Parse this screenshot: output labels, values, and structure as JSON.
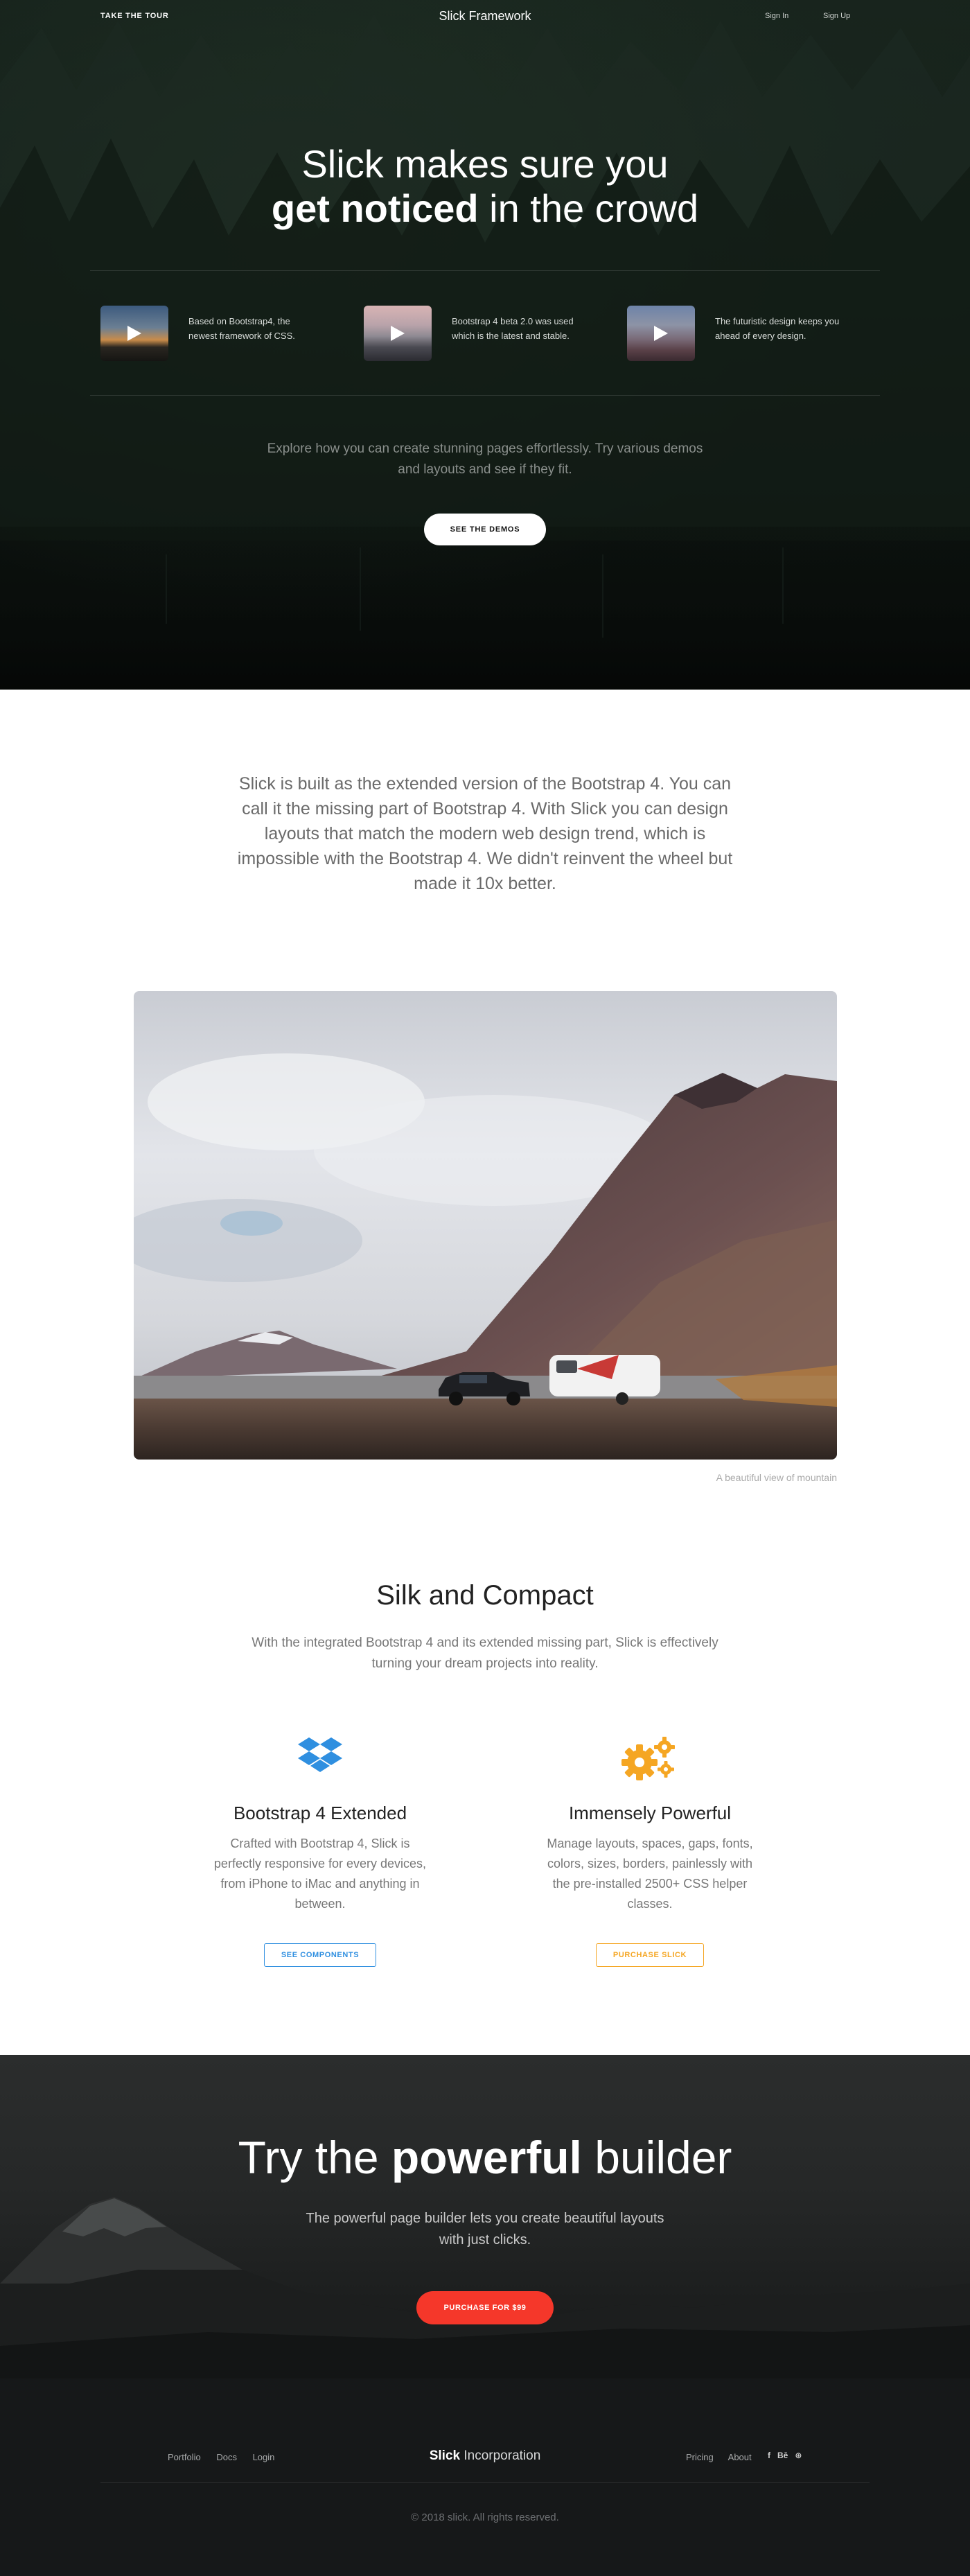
{
  "nav": {
    "tour": "TAKE THE TOUR",
    "brand": "Slick Framework",
    "signin": "Sign In",
    "signup": "Sign Up"
  },
  "hero": {
    "title_line1": "Slick makes sure you",
    "title_bold": "get noticed",
    "title_rest": " in the crowd",
    "videos": [
      {
        "text": "Based on Bootstrap4, the newest framework of CSS.",
        "icon": "play-icon"
      },
      {
        "text": "Bootstrap 4 beta 2.0 was used which is the latest and stable.",
        "icon": "play-icon"
      },
      {
        "text": "The futuristic design keeps you ahead of every design.",
        "icon": "play-icon"
      }
    ],
    "explore": "Explore how you can create stunning pages effortlessly. Try various demos and layouts and see if they fit.",
    "cta": "SEE THE DEMOS"
  },
  "intro": {
    "text": "Slick is built as the extended version of the Bootstrap 4. You can call it the missing part of Bootstrap 4. With Slick you can design layouts that match the modern web design trend, which is impossible with the Bootstrap 4. We didn't reinvent the wheel but made it 10x better."
  },
  "photo": {
    "caption": "A beautiful view of mountain"
  },
  "features": {
    "title": "Silk and Compact",
    "subtitle": "With the integrated Bootstrap 4 and its extended missing part, Slick is effectively turning your dream projects into reality.",
    "items": [
      {
        "icon": "dropbox-icon",
        "title": "Bootstrap 4 Extended",
        "text": "Crafted with Bootstrap 4, Slick is perfectly responsive for every devices, from iPhone to iMac and anything in between.",
        "button": "SEE COMPONENTS",
        "color": "#2f8fe0"
      },
      {
        "icon": "gears-icon",
        "title": "Immensely Powerful",
        "text": "Manage layouts, spaces, gaps, fonts, colors, sizes, borders, painlessly with the pre-installed 2500+ CSS helper classes.",
        "button": "PURCHASE SLICK",
        "color": "#f5a623"
      }
    ]
  },
  "builder": {
    "title_pre": "Try the ",
    "title_bold": "powerful",
    "title_post": " builder",
    "subtitle": "The powerful page builder lets you create beautiful layouts with just clicks.",
    "button": "PURCHASE FOR $99",
    "accent": "#f5372a"
  },
  "footer": {
    "links_left": [
      "Portfolio",
      "Docs",
      "Login"
    ],
    "brand_bold": "Slick",
    "brand_rest": " Incorporation",
    "links_right": [
      "Pricing",
      "About"
    ],
    "social": [
      {
        "icon": "facebook-icon",
        "glyph": "f"
      },
      {
        "icon": "behance-icon",
        "glyph": "Bē"
      },
      {
        "icon": "dribbble-icon",
        "glyph": "⊛"
      }
    ],
    "copyright": "© 2018 slick. All rights reserved."
  }
}
